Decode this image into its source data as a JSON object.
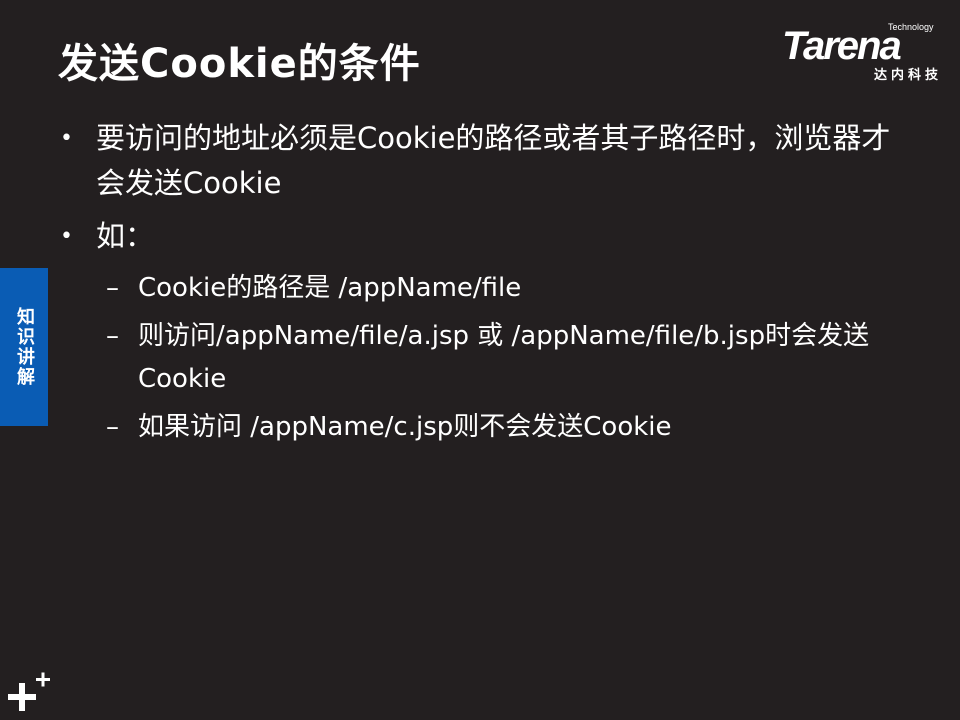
{
  "slide": {
    "title": "发送Cookie的条件",
    "side_tab": "知识讲解",
    "logo": {
      "tagline": "Technology",
      "name": "Tarena",
      "subtitle": "达内科技"
    },
    "bullets": [
      {
        "level": 1,
        "marker": "•",
        "text": "要访问的地址必须是Cookie的路径或者其子路径时，浏览器才会发送Cookie"
      },
      {
        "level": 1,
        "marker": "•",
        "text": "如："
      },
      {
        "level": 2,
        "marker": "–",
        "text": "Cookie的路径是 /appName/file"
      },
      {
        "level": 2,
        "marker": "–",
        "text": "则访问/appName/file/a.jsp 或 /appName/file/b.jsp时会发送Cookie"
      },
      {
        "level": 2,
        "marker": "–",
        "text": "如果访问 /appName/c.jsp则不会发送Cookie"
      }
    ],
    "colors": {
      "background": "#231f20",
      "text": "#ffffff",
      "side_tab": "#0a5cb4"
    },
    "icons": [
      "plus-plus-icon"
    ]
  }
}
